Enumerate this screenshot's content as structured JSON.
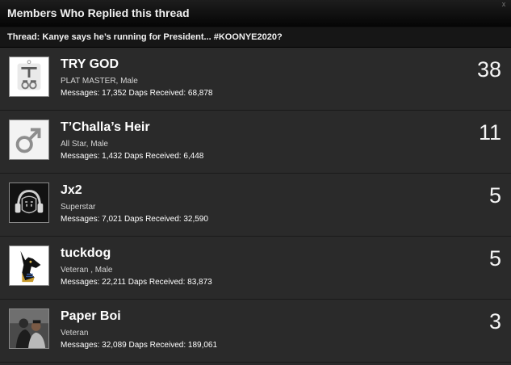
{
  "dialog": {
    "title": "Members Who Replied this thread",
    "close_glyph": "x",
    "thread_prefix": "Thread:",
    "thread_title": "Kanye says he’s running for President... #KOONYE2020?"
  },
  "labels": {
    "messages": "Messages:",
    "daps_received": "Daps Received:"
  },
  "members": [
    {
      "name": "TRY GOD",
      "title": "PLAT MASTER, Male",
      "messages": "17,352",
      "daps": "68,878",
      "replies": "38",
      "avatar_icon": "try-god-pendant-avatar-icon"
    },
    {
      "name": "T’Challa’s Heir",
      "title": "All Star, Male",
      "messages": "1,432",
      "daps": "6,448",
      "replies": "11",
      "avatar_icon": "male-symbol-icon"
    },
    {
      "name": "Jx2",
      "title": "Superstar",
      "messages": "7,021",
      "daps": "32,590",
      "replies": "5",
      "avatar_icon": "headphones-face-icon"
    },
    {
      "name": "tuckdog",
      "title": "Veteran , Male",
      "messages": "22,211",
      "daps": "83,873",
      "replies": "5",
      "avatar_icon": "anubis-icon"
    },
    {
      "name": "Paper Boi",
      "title": "Veteran",
      "messages": "32,089",
      "daps": "189,061",
      "replies": "3",
      "avatar_icon": "photo-avatar-icon"
    }
  ]
}
